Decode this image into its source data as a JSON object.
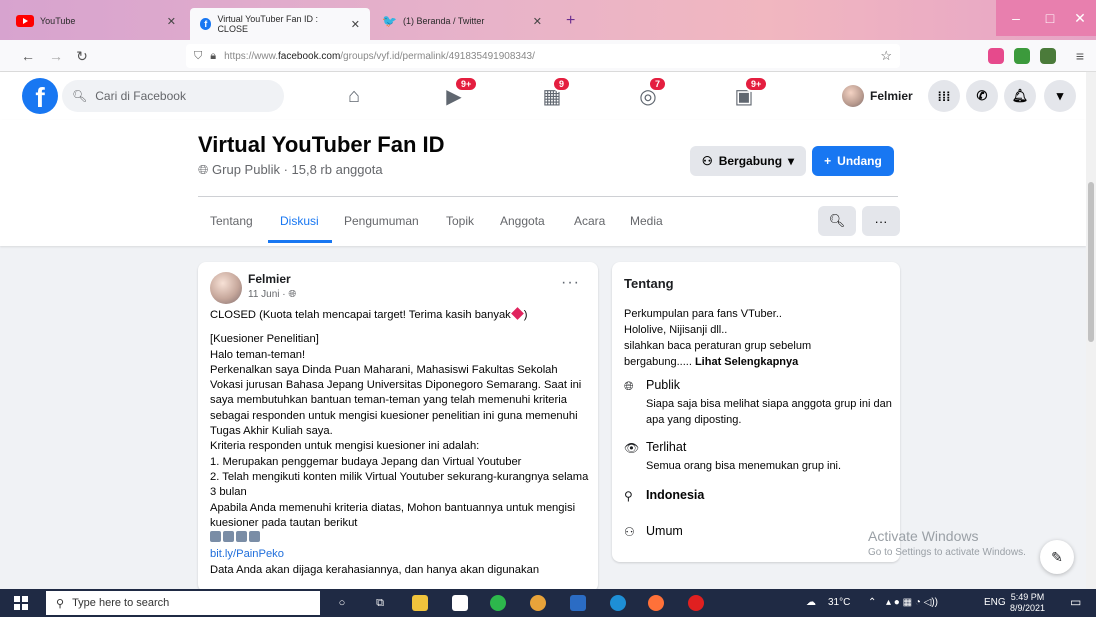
{
  "browser": {
    "tabs": [
      {
        "label": "YouTube"
      },
      {
        "label": "Virtual YouTuber Fan ID : CLOSE"
      },
      {
        "label": "(1) Beranda / Twitter"
      }
    ],
    "url_prefix": "https://www.",
    "url_domain": "facebook.com",
    "url_path": "/groups/vyf.id/permalink/491835491908343/"
  },
  "facebook": {
    "search_placeholder": "Cari di Facebook",
    "badges": {
      "watch": "9+",
      "marketplace": "9",
      "groups": "7",
      "gaming": "9+"
    },
    "profile_name": "Felmier"
  },
  "group": {
    "title": "Virtual YouTuber Fan ID",
    "meta": "Grup Publik · 15,8 rb anggota",
    "join_label": "Bergabung",
    "invite_label": "Undang",
    "tabs": [
      "Tentang",
      "Diskusi",
      "Pengumuman",
      "Topik",
      "Anggota",
      "Acara",
      "Media"
    ],
    "active_tab": "Diskusi"
  },
  "post": {
    "author": "Felmier",
    "date": "11 Juni · ",
    "line_closed": "CLOSED (Kuota telah mencapai target! Terima kasih banyak",
    "line_closed_end": ")",
    "lines": [
      "[Kuesioner Penelitian]",
      "Halo teman-teman!",
      "Perkenalkan saya Dinda Puan Maharani, Mahasiswi Fakultas Sekolah Vokasi jurusan Bahasa Jepang Universitas Diponegoro Semarang. Saat ini saya membutuhkan bantuan teman-teman yang telah memenuhi kriteria sebagai responden untuk mengisi kuesioner penelitian ini guna memenuhi Tugas Akhir Kuliah saya.",
      "Kriteria responden untuk mengisi kuesioner ini adalah:",
      "1. Merupakan penggemar budaya Jepang dan Virtual Youtuber",
      "2. Telah mengikuti konten milik Virtual Youtuber sekurang-kurangnya selama 3 bulan",
      "Apabila Anda memenuhi kriteria diatas, Mohon bantuannya untuk mengisi kuesioner pada tautan berikut"
    ],
    "link": "bit.ly/PainPeko",
    "last_line": "Data Anda akan dijaga kerahasiannya, dan hanya akan digunakan"
  },
  "about": {
    "heading": "Tentang",
    "desc_1": "Perkumpulan para fans VTuber..",
    "desc_2": "Hololive, Nijisanji dll..",
    "desc_3": "silahkan baca peraturan grup sebelum",
    "desc_4": "bergabung..... ",
    "see_more": "Lihat Selengkapnya",
    "public_title": "Publik",
    "public_desc": "Siapa saja bisa melihat siapa anggota grup ini dan apa yang diposting.",
    "visible_title": "Terlihat",
    "visible_desc": "Semua orang bisa menemukan grup ini.",
    "location": "Indonesia",
    "category": "Umum"
  },
  "windows": {
    "activate_title": "Activate Windows",
    "activate_sub": "Go to Settings to activate Windows.",
    "search_placeholder": "Type here to search",
    "weather": "31°C",
    "lang": "ENG",
    "time": "5:49 PM",
    "date": "8/9/2021"
  },
  "colors": {
    "fb_blue": "#1877f2",
    "badge_red": "#e41e3f",
    "taskbar": "#1f2a44"
  }
}
